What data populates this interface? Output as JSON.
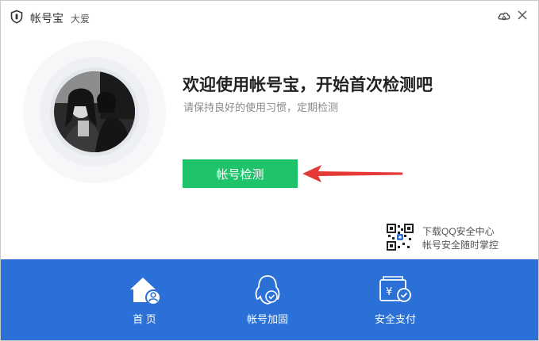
{
  "window": {
    "app_title": "帐号宝",
    "user_name": "大爱"
  },
  "main": {
    "headline": "欢迎使用帐号宝，开始首次检测吧",
    "subline": "请保持良好的使用习惯，定期检测",
    "check_button_label": "帐号检测",
    "promo_line1": "下载QQ安全中心",
    "promo_line2": "帐号安全随时掌控"
  },
  "nav": {
    "items": [
      {
        "label": "首 页",
        "icon": "home-user-icon"
      },
      {
        "label": "帐号加固",
        "icon": "penguin-shield-icon"
      },
      {
        "label": "安全支付",
        "icon": "wallet-check-icon"
      }
    ]
  },
  "colors": {
    "accent_green": "#1ec36a",
    "nav_blue": "#2b70d6",
    "arrow_red": "#e53935"
  }
}
